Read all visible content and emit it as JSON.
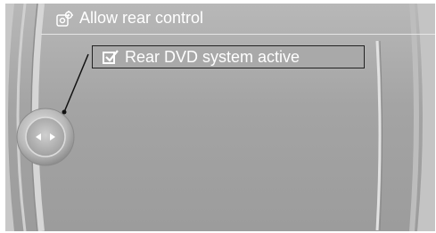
{
  "header": {
    "title": "Allow rear control",
    "icon": "settings-gear-icon"
  },
  "menu": {
    "items": [
      {
        "label": "Rear DVD system active",
        "checked": true,
        "selected": true,
        "icon": "checkbox-checked-icon"
      }
    ]
  },
  "controller": {
    "icon": "idrive-controller-icon",
    "left_arrow": "controller-left-arrow-icon",
    "right_arrow": "controller-right-arrow-icon"
  },
  "colors": {
    "screen_background": "#a4a4a4",
    "text": "#ffffff",
    "selection_border": "#222222"
  }
}
